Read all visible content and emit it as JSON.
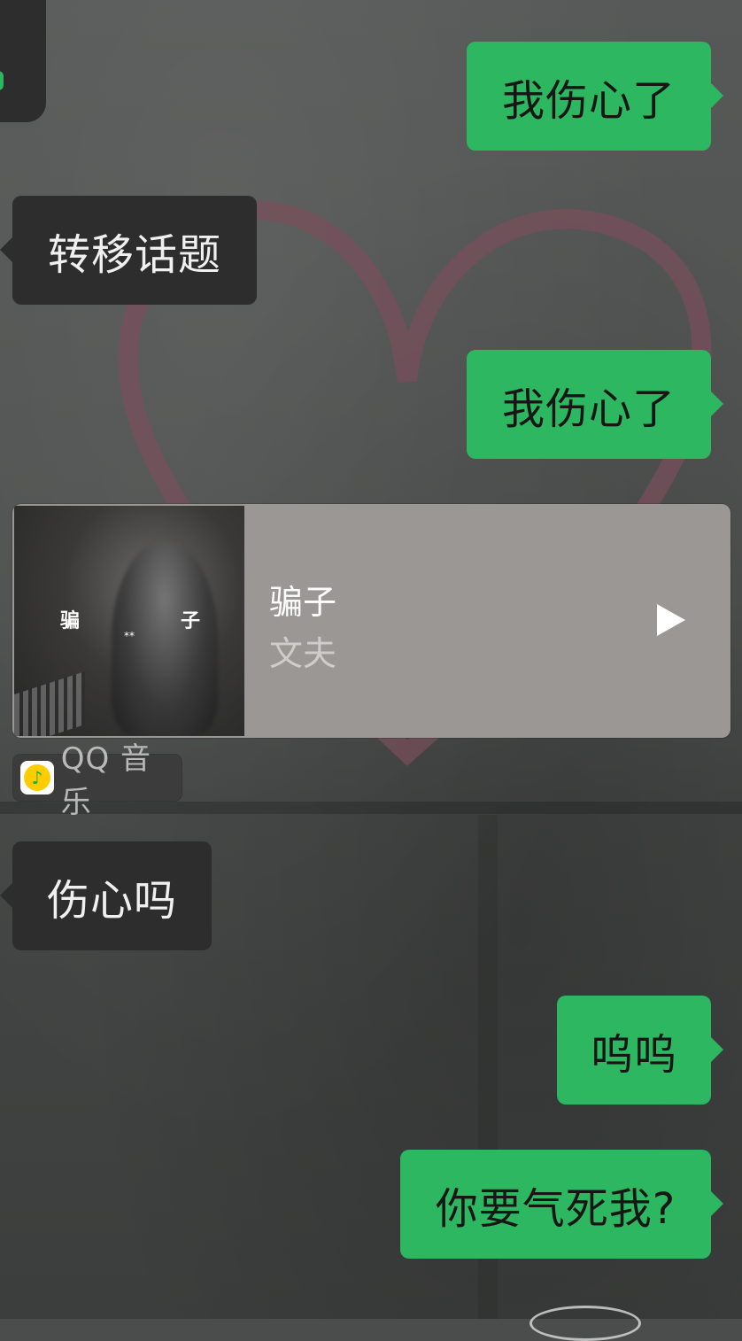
{
  "messages": [
    {
      "text": "我伤心了",
      "direction": "sent"
    },
    {
      "text": "转移话题",
      "direction": "received"
    },
    {
      "text": "我伤心了",
      "direction": "sent"
    },
    {
      "text": "伤心吗",
      "direction": "received"
    },
    {
      "text": "呜呜",
      "direction": "sent"
    },
    {
      "text": "你要气死我?",
      "direction": "sent"
    }
  ],
  "music_card": {
    "title": "骗子",
    "artist": "文夫",
    "album_text_left": "骗",
    "album_text_right": "子",
    "album_stars": "**",
    "source": "QQ 音乐",
    "source_icon": "qq-music-icon"
  },
  "colors": {
    "sent_bubble": "#2db760",
    "received_bubble": "#2d2d2d",
    "card_background": "#9a9795"
  }
}
